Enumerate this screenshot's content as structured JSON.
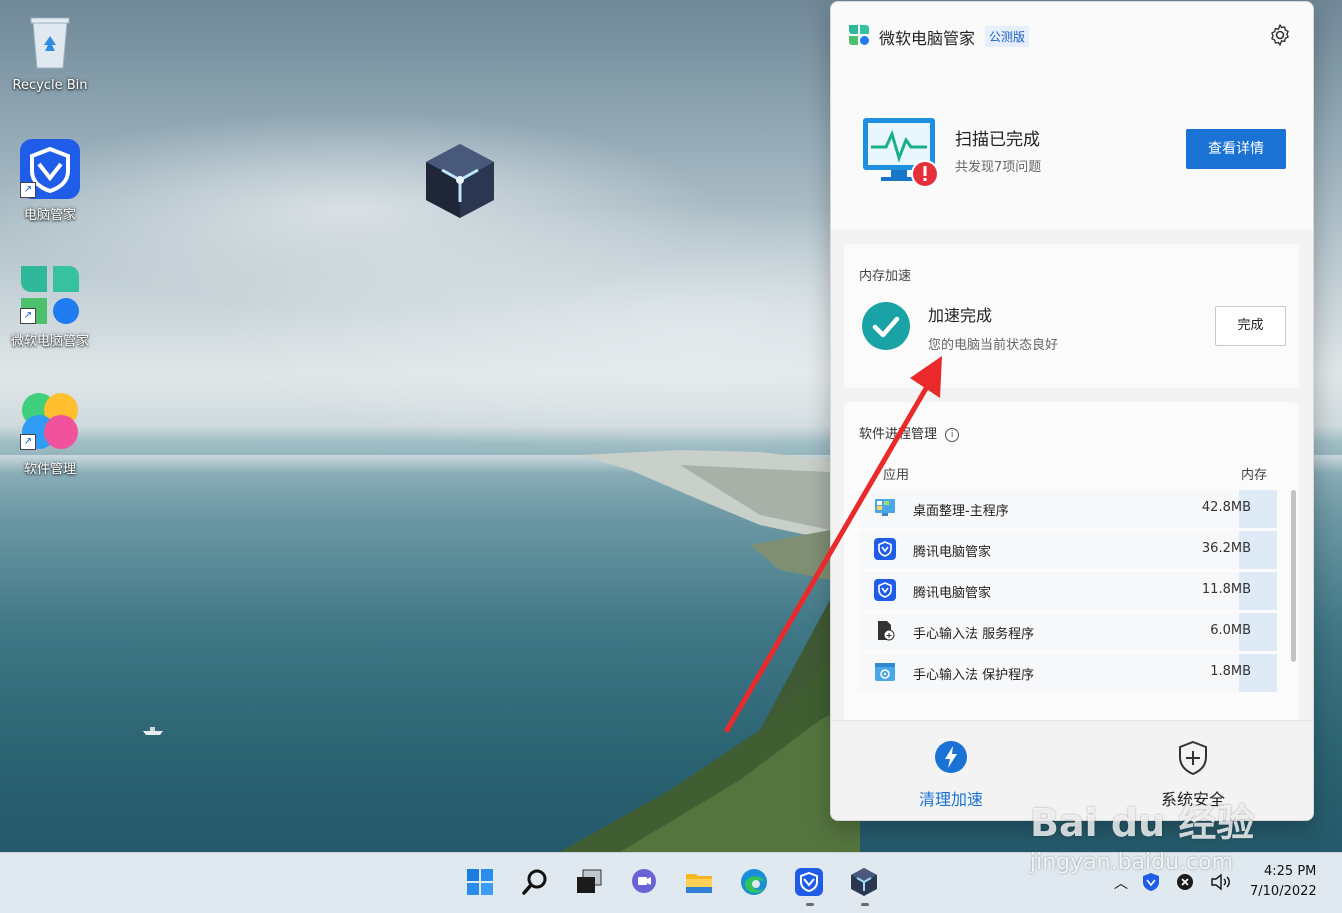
{
  "desktop": {
    "icons": [
      {
        "label": "Recycle Bin",
        "icon": "recycle-bin-icon"
      },
      {
        "label": "电脑管家",
        "icon": "tencent-pc-manager-icon"
      },
      {
        "label": "微软电脑管家",
        "icon": "microsoft-pc-manager-icon"
      },
      {
        "label": "软件管理",
        "icon": "software-manager-icon"
      }
    ]
  },
  "panel": {
    "app_title": "微软电脑管家",
    "badge": "公测版",
    "settings_icon": "gear-icon",
    "scan": {
      "title": "扫描已完成",
      "subtitle": "共发现7项问题",
      "button": "查看详情"
    },
    "memory": {
      "section_title": "内存加速",
      "status_title": "加速完成",
      "status_subtitle": "您的电脑当前状态良好",
      "button": "完成"
    },
    "software": {
      "section_title": "软件进程管理",
      "columns": {
        "app": "应用",
        "memory": "内存"
      },
      "rows": [
        {
          "name": "桌面整理-主程序",
          "memory": "42.8MB",
          "icon": "desktop-organizer-icon"
        },
        {
          "name": "腾讯电脑管家",
          "memory": "36.2MB",
          "icon": "tencent-shield-icon"
        },
        {
          "name": "腾讯电脑管家",
          "memory": "11.8MB",
          "icon": "tencent-shield-icon"
        },
        {
          "name": "手心输入法 服务程序",
          "memory": "6.0MB",
          "icon": "input-method-service-icon"
        },
        {
          "name": "手心输入法 保护程序",
          "memory": "1.8MB",
          "icon": "input-method-protect-icon"
        }
      ]
    },
    "nav": {
      "clean": "清理加速",
      "security": "系统安全"
    },
    "colors": {
      "accent": "#1a73d4",
      "success": "#1aa3a6",
      "alert": "#e5303c"
    }
  },
  "taskbar": {
    "icons": [
      "windows-start-icon",
      "search-icon",
      "task-view-icon",
      "chat-icon",
      "file-explorer-icon",
      "edge-icon",
      "tencent-pc-manager-icon",
      "cube-app-icon"
    ],
    "clock": {
      "time": "4:25 PM",
      "date": "7/10/2022"
    }
  },
  "watermark": {
    "brand": "Bai du 经验",
    "url": "jingyan.baidu.com"
  }
}
